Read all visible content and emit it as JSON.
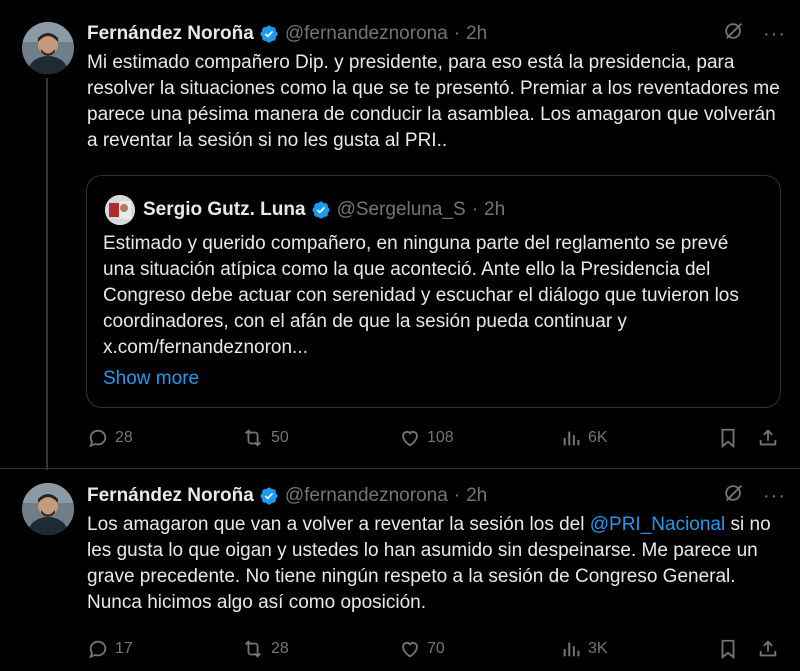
{
  "tweets": [
    {
      "author": "Fernández Noroña",
      "handle": "@fernandeznorona",
      "separator": "·",
      "time": "2h",
      "text": "Mi estimado compañero Dip. y presidente, para eso está la presidencia, para resolver la situaciones como la que se te presentó. Premiar a los reventadores me parece una pésima manera de conducir la asamblea. Los amagaron que volverán a reventar la sesión si no les gusta al PRI..",
      "quote": {
        "author": "Sergio Gutz. Luna",
        "handle": "@Sergeluna_S",
        "separator": "·",
        "time": "2h",
        "text": "Estimado y querido compañero, en ninguna parte del reglamento se prevé una situación atípica como la que aconteció. Ante ello la Presidencia del Congreso debe actuar con serenidad y escuchar el diálogo que tuvieron los coordinadores, con el afán de que la sesión pueda continuar y x.com/fernandeznoron...",
        "show_more": "Show more"
      },
      "stats": {
        "replies": "28",
        "reposts": "50",
        "likes": "108",
        "views": "6K"
      }
    },
    {
      "author": "Fernández Noroña",
      "handle": "@fernandeznorona",
      "separator": "·",
      "time": "2h",
      "text_before": "Los amagaron que van a volver a reventar la sesión los del ",
      "mention": "@PRI_Nacional",
      "text_after": " si no les gusta lo que oigan y ustedes lo han asumido sin despeinarse. Me parece un grave precedente. No tiene ningún respeto a la sesión de Congreso General. Nunca hicimos algo así como oposición.",
      "stats": {
        "replies": "17",
        "reposts": "28",
        "likes": "70",
        "views": "3K"
      }
    }
  ],
  "icons": {
    "verified": "verified-badge-icon",
    "grok": "grok-icon",
    "more": "more-icon",
    "reply": "reply-icon",
    "repost": "repost-icon",
    "like": "like-icon",
    "views": "views-icon",
    "bookmark": "bookmark-icon",
    "share": "share-icon"
  },
  "colors": {
    "background": "#000000",
    "text": "#e7e9ea",
    "muted": "#71767b",
    "link": "#1d9bf0",
    "border": "#2f3336"
  }
}
